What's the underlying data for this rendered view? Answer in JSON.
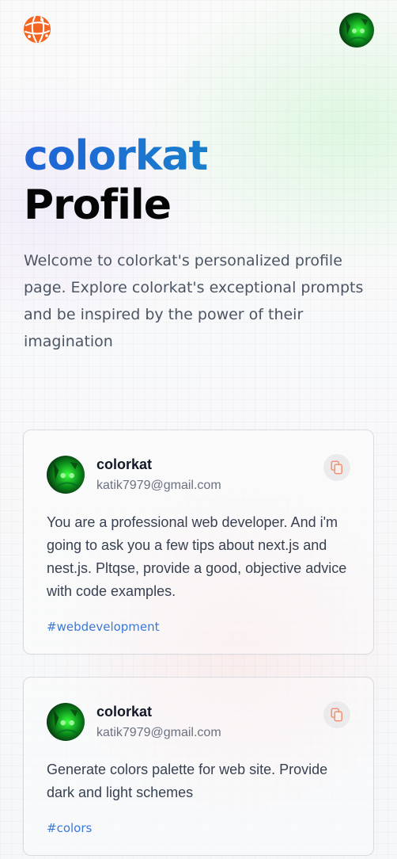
{
  "header": {
    "logo_icon": "globe-logo-icon",
    "avatar_icon": "user-avatar-icon"
  },
  "hero": {
    "title_accent": "colorkat",
    "title_main": "Profile",
    "description": "Welcome to colorkat's personalized profile page. Explore colorkat's exceptional prompts and be inspired by the power of their imagination"
  },
  "posts": [
    {
      "username": "colorkat",
      "email": "katik7979@gmail.com",
      "prompt": "You are a professional web developer. And i'm going to ask you a few tips about next.js and nest.js. Pltqse, provide a good, objective advice with code examples.",
      "tag": "#webdevelopment",
      "copy_icon": "copy-icon"
    },
    {
      "username": "colorkat",
      "email": "katik7979@gmail.com",
      "prompt": "Generate colors palette for web site. Provide dark and light schemes",
      "tag": "#colors",
      "copy_icon": "copy-icon"
    }
  ],
  "colors": {
    "accent_start": "#1f63d6",
    "accent_end": "#1598c4",
    "logo_orange": "#f26522",
    "tag_blue": "#3a78d8",
    "copy_icon_orange": "#f28b6a"
  }
}
